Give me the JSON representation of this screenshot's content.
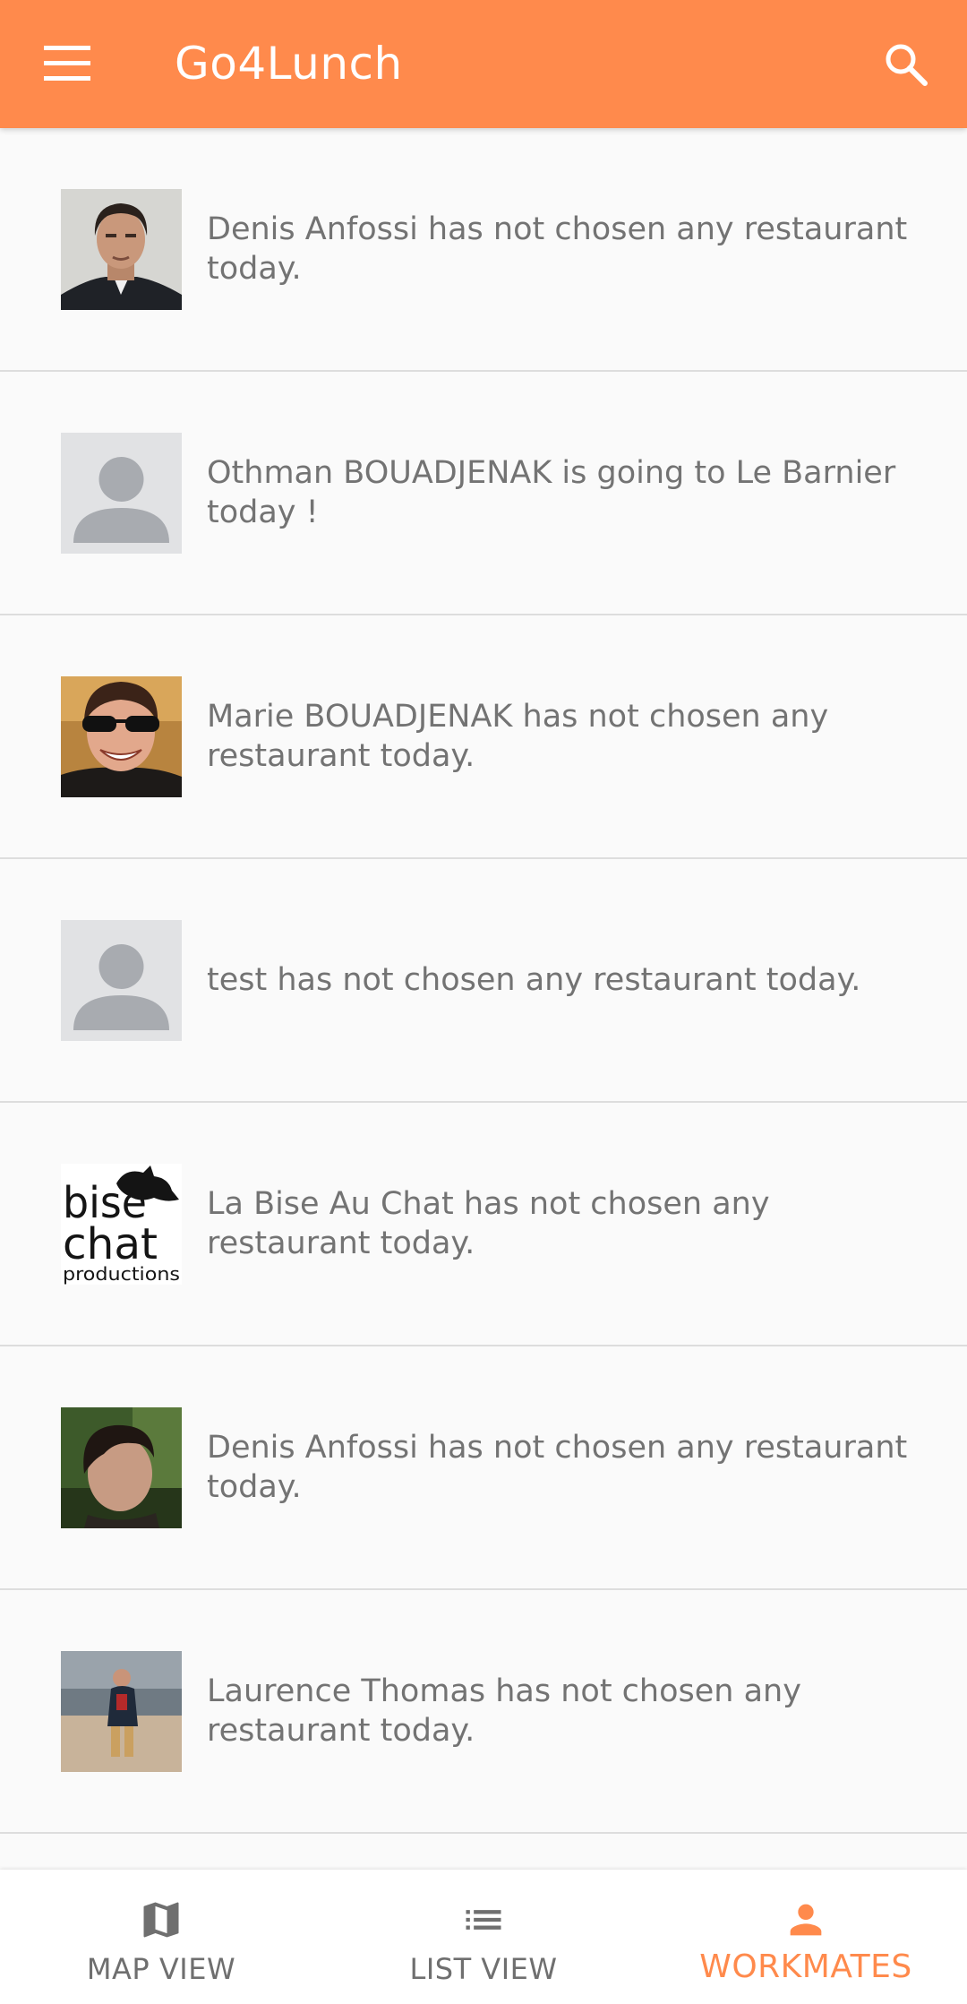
{
  "app_bar": {
    "title": "Go4Lunch",
    "menu_icon": "menu-icon",
    "search_icon": "search-icon",
    "color": "#ff8a4c"
  },
  "workmates": [
    {
      "text": "Denis Anfossi has not chosen any restaurant today.",
      "avatar": "photo"
    },
    {
      "text": "Othman BOUADJENAK is going to Le Barnier today !",
      "avatar": "default-person"
    },
    {
      "text": "Marie BOUADJENAK has not chosen any restaurant today.",
      "avatar": "photo"
    },
    {
      "text": "test has not chosen any restaurant today.",
      "avatar": "default-person"
    },
    {
      "text": "La Bise Au Chat has not chosen any restaurant today.",
      "avatar": "logo",
      "logo_text": "bise chat productions"
    },
    {
      "text": "Denis Anfossi has not chosen any restaurant today.",
      "avatar": "photo"
    },
    {
      "text": "Laurence Thomas has not chosen any restaurant today.",
      "avatar": "photo"
    }
  ],
  "bottom_nav": {
    "items": [
      {
        "label": "MAP VIEW",
        "icon": "map-icon",
        "active": false
      },
      {
        "label": "LIST VIEW",
        "icon": "list-icon",
        "active": false
      },
      {
        "label": "WORKMATES",
        "icon": "person-icon",
        "active": true
      }
    ],
    "active_color": "#ff8a4c",
    "inactive_color": "#6f6f6f"
  }
}
